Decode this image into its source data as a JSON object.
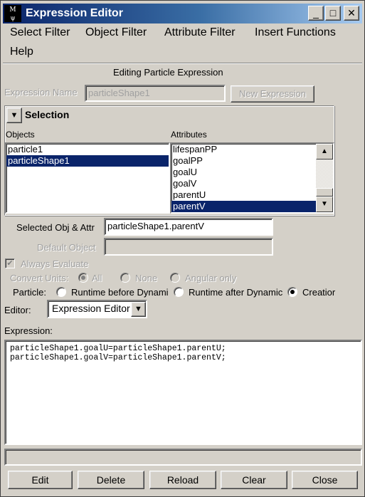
{
  "window": {
    "title": "Expression Editor",
    "app_icon_label": "Maya",
    "controls": {
      "minimize": "_",
      "maximize": "□",
      "close": "✕"
    }
  },
  "menu": [
    "Select Filter",
    "Object Filter",
    "Attribute Filter",
    "Insert Functions",
    "Help"
  ],
  "header": {
    "subtitle": "Editing Particle Expression"
  },
  "expression_name": {
    "label": "Expression Name",
    "value": "particleShape1",
    "new_button": "New Expression"
  },
  "selection": {
    "title": "Selection",
    "objects_label": "Objects",
    "attributes_label": "Attributes",
    "objects": [
      {
        "name": "particle1",
        "selected": false
      },
      {
        "name": "particleShape1",
        "selected": true
      }
    ],
    "attributes": [
      {
        "name": "lifespanPP",
        "selected": false
      },
      {
        "name": "goalPP",
        "selected": false
      },
      {
        "name": "goalU",
        "selected": false
      },
      {
        "name": "goalV",
        "selected": false
      },
      {
        "name": "parentU",
        "selected": false
      },
      {
        "name": "parentV",
        "selected": true
      }
    ],
    "selected_label": "Selected Obj & Attr",
    "selected_value": "particleShape1.parentV",
    "default_object_label": "Default Object",
    "default_object_value": ""
  },
  "options": {
    "always_evaluate": {
      "label": "Always Evaluate",
      "checked": true,
      "disabled": true
    },
    "convert_units": {
      "label": "Convert Units:",
      "options": [
        "All",
        "None",
        "Angular only"
      ],
      "selected": "All",
      "disabled": true
    },
    "particle": {
      "label": "Particle:",
      "options": [
        "Runtime before Dynami",
        "Runtime after Dynamic",
        "Creatior"
      ],
      "selected": "Creatior"
    }
  },
  "editor": {
    "label": "Editor:",
    "value": "Expression Editor"
  },
  "expression": {
    "label": "Expression:",
    "lines": [
      "particleShape1.goalU=particleShape1.parentU;",
      "particleShape1.goalV=particleShape1.parentV;"
    ]
  },
  "status_text": "",
  "buttons": [
    "Edit",
    "Delete",
    "Reload",
    "Clear",
    "Close"
  ]
}
